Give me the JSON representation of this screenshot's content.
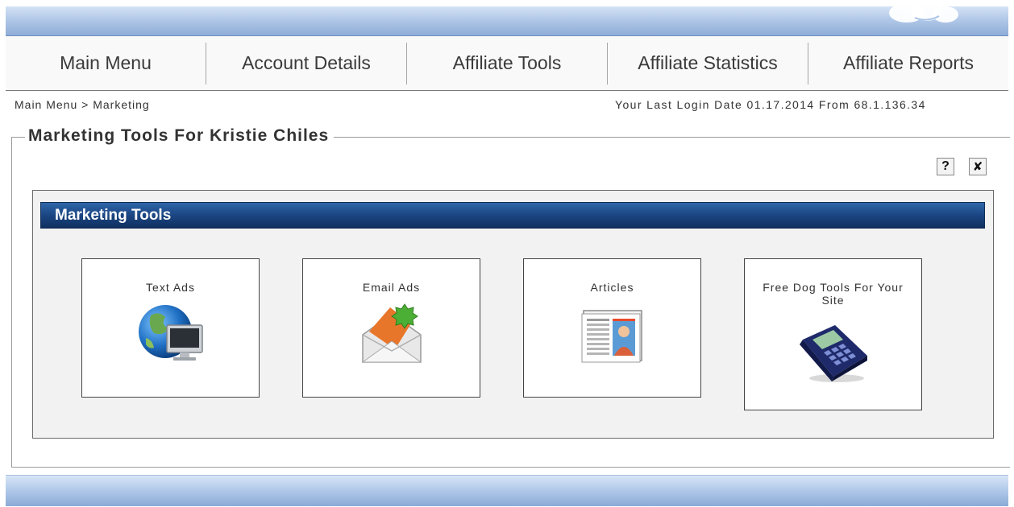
{
  "nav": {
    "items": [
      {
        "label": "Main Menu"
      },
      {
        "label": "Account Details"
      },
      {
        "label": "Affiliate Tools"
      },
      {
        "label": "Affiliate Statistics"
      },
      {
        "label": "Affiliate Reports"
      }
    ]
  },
  "breadcrumb": {
    "home": "Main Menu",
    "separator": ">",
    "current": "Marketing"
  },
  "last_login": "Your Last Login Date 01.17.2014 From 68.1.136.34",
  "fieldset": {
    "legend": "Marketing Tools For Kristie Chiles",
    "help_label": "?",
    "close_label": "✘"
  },
  "panel": {
    "title": "Marketing Tools",
    "tiles": [
      {
        "label": "Text Ads",
        "icon": "globe-computer-icon"
      },
      {
        "label": "Email Ads",
        "icon": "envelope-badge-icon"
      },
      {
        "label": "Articles",
        "icon": "newspaper-icon"
      },
      {
        "label": "Free Dog Tools For Your Site",
        "icon": "calculator-icon"
      }
    ]
  },
  "colors": {
    "header_blue": "#1b4683",
    "band_blue": "#b1c8e8",
    "panel_bg": "#f2f2f2"
  }
}
